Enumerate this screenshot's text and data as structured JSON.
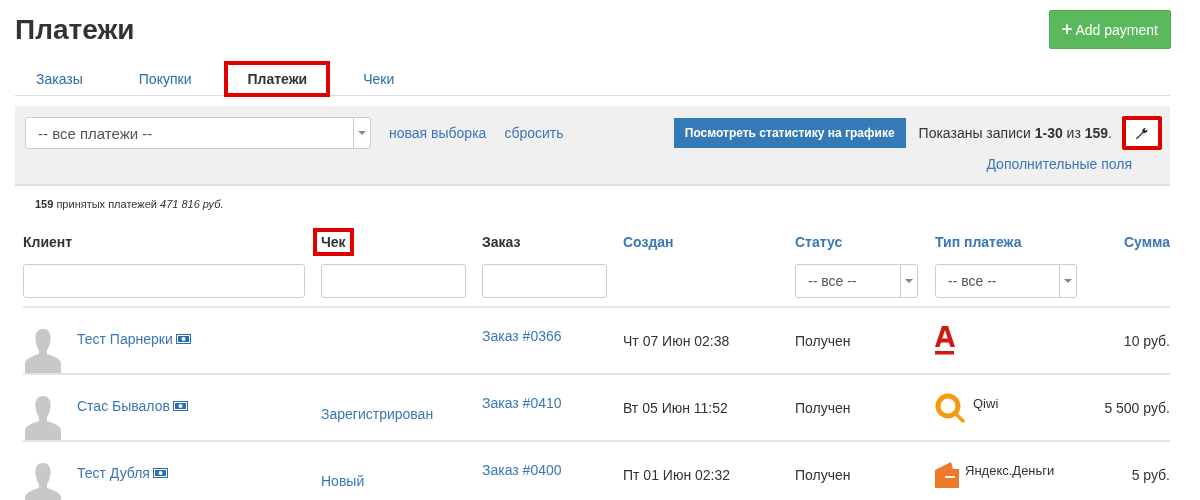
{
  "page_title": "Платежи",
  "add_button": {
    "icon": "+",
    "label": "Add payment"
  },
  "tabs": [
    {
      "label": "Заказы",
      "selected": false,
      "highlighted": false
    },
    {
      "label": "Покупки",
      "selected": false,
      "highlighted": false
    },
    {
      "label": "Платежи",
      "selected": true,
      "highlighted": true
    },
    {
      "label": "Чеки",
      "selected": false,
      "highlighted": false
    }
  ],
  "filter_panel": {
    "select_value": "-- все платежи --",
    "links": [
      "новая выборка",
      "сбросить"
    ],
    "stats_button": "Посмотреть статистику на графике",
    "shown_text": "Показаны записи **1-30** из **159**.",
    "settings_highlighted": true,
    "extra_fields_link": "Дополнительные поля"
  },
  "summary": "**159** принятых платежей *471 816 руб.*",
  "table": {
    "columns": [
      {
        "label": "Клиент",
        "sortable": false,
        "highlighted": false
      },
      {
        "label": "Чек",
        "sortable": false,
        "highlighted": true
      },
      {
        "label": "Заказ",
        "sortable": false,
        "highlighted": false
      },
      {
        "label": "Создан",
        "sortable": true,
        "highlighted": false
      },
      {
        "label": "Статус",
        "sortable": true,
        "highlighted": false
      },
      {
        "label": "Тип платежа",
        "sortable": true,
        "highlighted": false
      },
      {
        "label": "Сумма",
        "sortable": true,
        "highlighted": false
      }
    ],
    "filters": [
      {
        "kind": "text"
      },
      {
        "kind": "text"
      },
      {
        "kind": "text"
      },
      {
        "kind": "none"
      },
      {
        "kind": "select",
        "value": "-- все --"
      },
      {
        "kind": "select",
        "value": "-- все --"
      },
      {
        "kind": "none"
      }
    ],
    "rows": [
      {
        "client": "Тест Парнерки",
        "receipt": "",
        "order": "Заказ #0366",
        "created": "Чт 07 Июн 02:38",
        "status": "Получен",
        "payment": {
          "kind": "alfa"
        },
        "amount": "10 руб."
      },
      {
        "client": "Стас Бывалов",
        "receipt": "Зарегистрирован",
        "order": "Заказ #0410",
        "created": "Вт 05 Июн 11:52",
        "status": "Получен",
        "payment": {
          "kind": "qiwi",
          "label": "Qiwi"
        },
        "amount": "5 500 руб."
      },
      {
        "client": "Тест Дубля",
        "receipt": "Новый",
        "order": "Заказ #0400",
        "created": "Пт 01 Июн 02:32",
        "status": "Получен",
        "payment": {
          "kind": "yandex",
          "label": "Яндекс.Деньги"
        },
        "amount": "5 руб."
      }
    ]
  }
}
